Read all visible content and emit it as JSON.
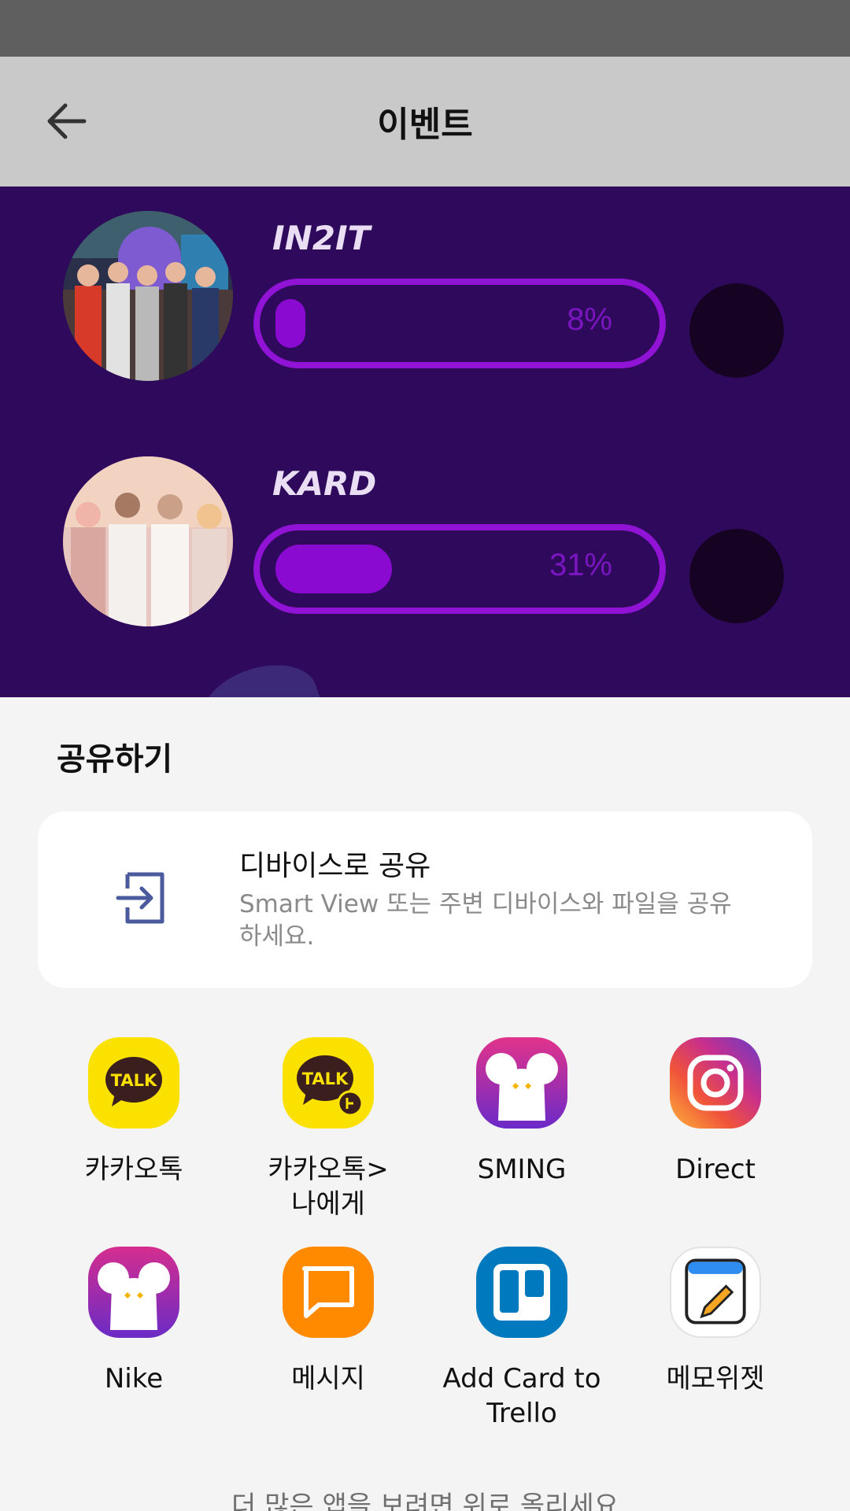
{
  "app_bar": {
    "title": "이벤트"
  },
  "event": {
    "candidates": [
      {
        "name": "IN2IT",
        "percent_label": "8%",
        "percent": 8
      },
      {
        "name": "KARD",
        "percent_label": "31%",
        "percent": 31
      }
    ]
  },
  "share": {
    "title": "공유하기",
    "device_share": {
      "title": "디바이스로 공유",
      "description": "Smart View 또는 주변 디바이스와 파일을 공유하세요."
    },
    "apps": [
      {
        "label": "카카오톡",
        "icon": "kakaotalk-icon"
      },
      {
        "label": "카카오톡>\n나에게",
        "icon": "kakaotalk-me-icon"
      },
      {
        "label": "SMING",
        "icon": "sming-icon"
      },
      {
        "label": "Direct",
        "icon": "instagram-icon"
      },
      {
        "label": "Nike",
        "icon": "nike-app-icon"
      },
      {
        "label": "메시지",
        "icon": "message-icon"
      },
      {
        "label": "Add Card to\nTrello",
        "icon": "trello-icon"
      },
      {
        "label": "메모위젯",
        "icon": "memo-widget-icon"
      }
    ],
    "more_hint": "더 많은 앱을 보려면 위로 올리세요"
  },
  "colors": {
    "event_bg": "#2f0a5c",
    "bar_purple": "#9013d6",
    "kakao_yellow": "#fae100",
    "message_orange": "#ff8a00",
    "trello_blue": "#0079bf"
  }
}
